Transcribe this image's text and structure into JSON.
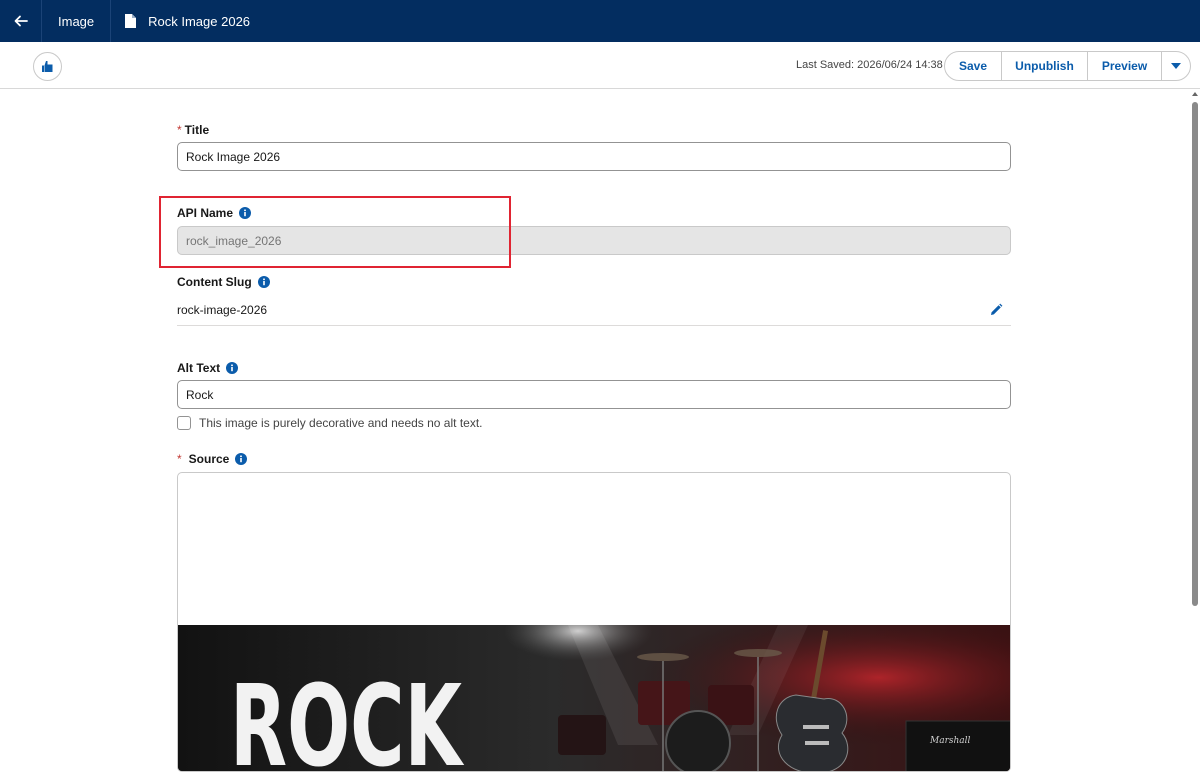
{
  "topbar": {
    "tab_image": "Image",
    "tab_doc": "Rock Image 2026"
  },
  "toolbar": {
    "last_saved": "Last Saved: 2026/06/24 14:38",
    "save": "Save",
    "unpublish": "Unpublish",
    "preview": "Preview"
  },
  "form": {
    "title_req": "*",
    "title_label": "Title",
    "title_value": "Rock Image 2026",
    "api_label": "API Name",
    "api_value": "rock_image_2026",
    "slug_label": "Content Slug",
    "slug_value": "rock-image-2026",
    "alt_label": "Alt Text",
    "alt_value": "Rock",
    "decorative_label": "This image is purely decorative and needs no alt text.",
    "source_req": "*",
    "source_label": "Source"
  },
  "image": {
    "headline": "ROCK",
    "amp_brand": "Marshall"
  },
  "colors": {
    "topbar": "#032d60",
    "accent": "#0b5cab",
    "highlight": "#e02432"
  }
}
